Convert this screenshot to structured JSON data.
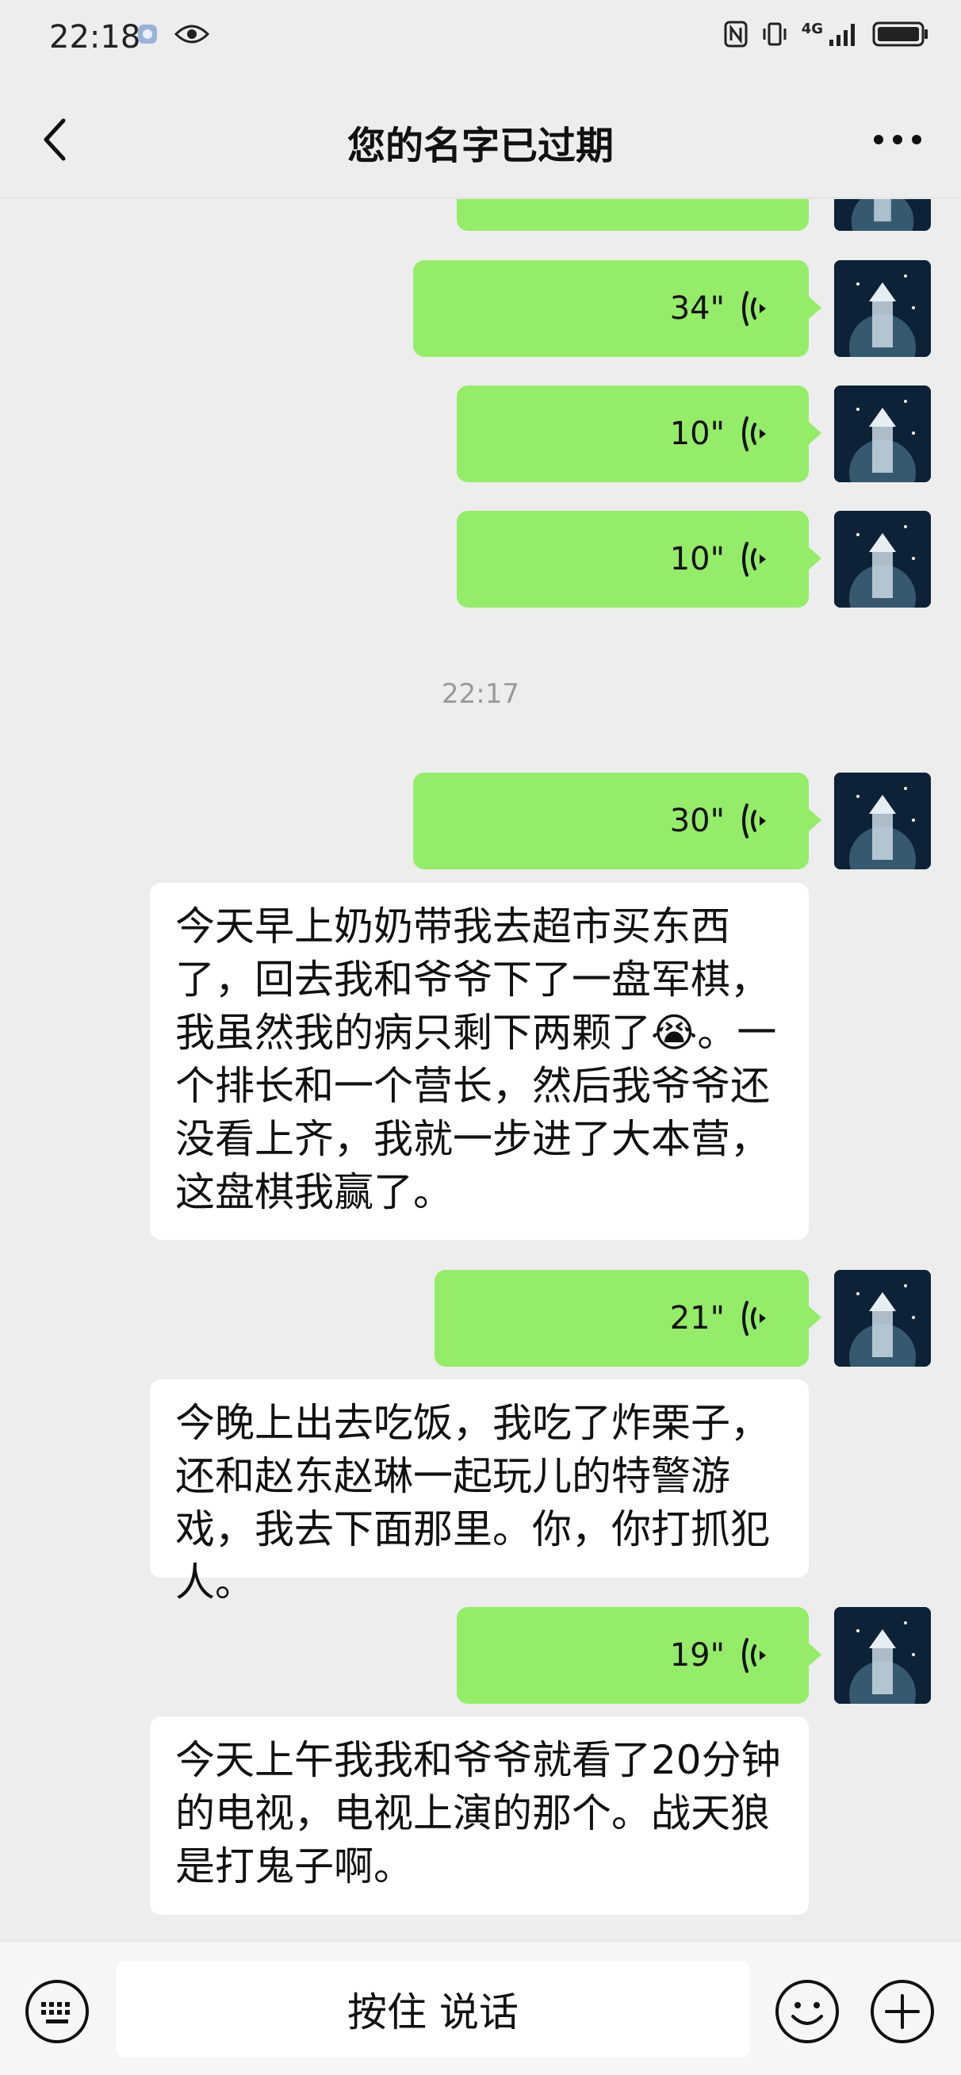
{
  "status_bar": {
    "time": "22:18",
    "network": "4G"
  },
  "header": {
    "title": "您的名字已过期"
  },
  "chat": {
    "voice_messages": [
      {
        "duration": "34\""
      },
      {
        "duration": "10\""
      },
      {
        "duration": "10\""
      },
      {
        "duration": "30\""
      },
      {
        "duration": "21\""
      },
      {
        "duration": "19\""
      }
    ],
    "timestamp": "22:17",
    "transcripts": [
      {
        "text": "今天早上奶奶带我去超市买东西了，回去我和爷爷下了一盘军棋，我虽然我的病只剩下两颗了😭。一个排长和一个营长，然后我爷爷还没看上齐，我就一步进了大本营，这盘棋我赢了。"
      },
      {
        "text": "今晚上出去吃饭，我吃了炸栗子，还和赵东赵琳一起玩儿的特警游戏，我去下面那里。你，你打抓犯人。"
      },
      {
        "text": "今天上午我我和爷爷就看了20分钟的电视，电视上演的那个。战天狼是打鬼子啊。"
      }
    ]
  },
  "input_bar": {
    "hold_to_talk_label": "按住 说话"
  },
  "colors": {
    "background": "#ededed",
    "voice_bubble": "#95ec69",
    "text_bubble": "#ffffff",
    "timestamp": "#9a9a9a"
  },
  "icons": [
    "back-arrow-icon",
    "more-icon",
    "voice-wave-icon",
    "keyboard-icon",
    "emoji-icon",
    "plus-icon",
    "avatar-image"
  ]
}
